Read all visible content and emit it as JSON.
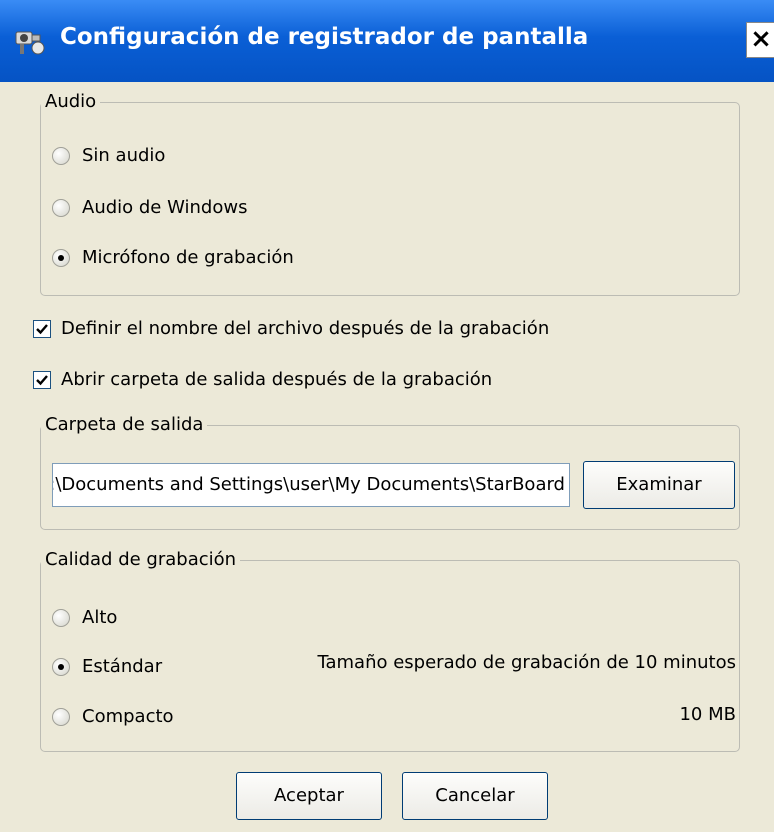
{
  "window": {
    "title": "Configuración de registrador de pantalla",
    "close_label": "×"
  },
  "audio": {
    "legend": "Audio",
    "options": [
      {
        "label": "Sin audio",
        "selected": false
      },
      {
        "label": "Audio de Windows",
        "selected": false
      },
      {
        "label": "Micrófono de grabación",
        "selected": true
      }
    ]
  },
  "checkboxes": [
    {
      "label": "Definir el nombre del archivo después de la grabación",
      "checked": true
    },
    {
      "label": "Abrir carpeta de salida después de la grabación",
      "checked": true
    }
  ],
  "output_folder": {
    "legend": "Carpeta de salida",
    "path": "C:\\Documents and Settings\\user\\My Documents\\StarBoard",
    "browse_label": "Examinar"
  },
  "quality": {
    "legend": "Calidad de grabación",
    "options": [
      {
        "label": "Alto",
        "selected": false
      },
      {
        "label": "Estándar",
        "selected": true
      },
      {
        "label": "Compacto",
        "selected": false
      }
    ],
    "expected_size_label": "Tamaño esperado de grabación de 10 minutos",
    "expected_size_value": "10 MB"
  },
  "footer": {
    "ok_label": "Aceptar",
    "cancel_label": "Cancelar"
  }
}
